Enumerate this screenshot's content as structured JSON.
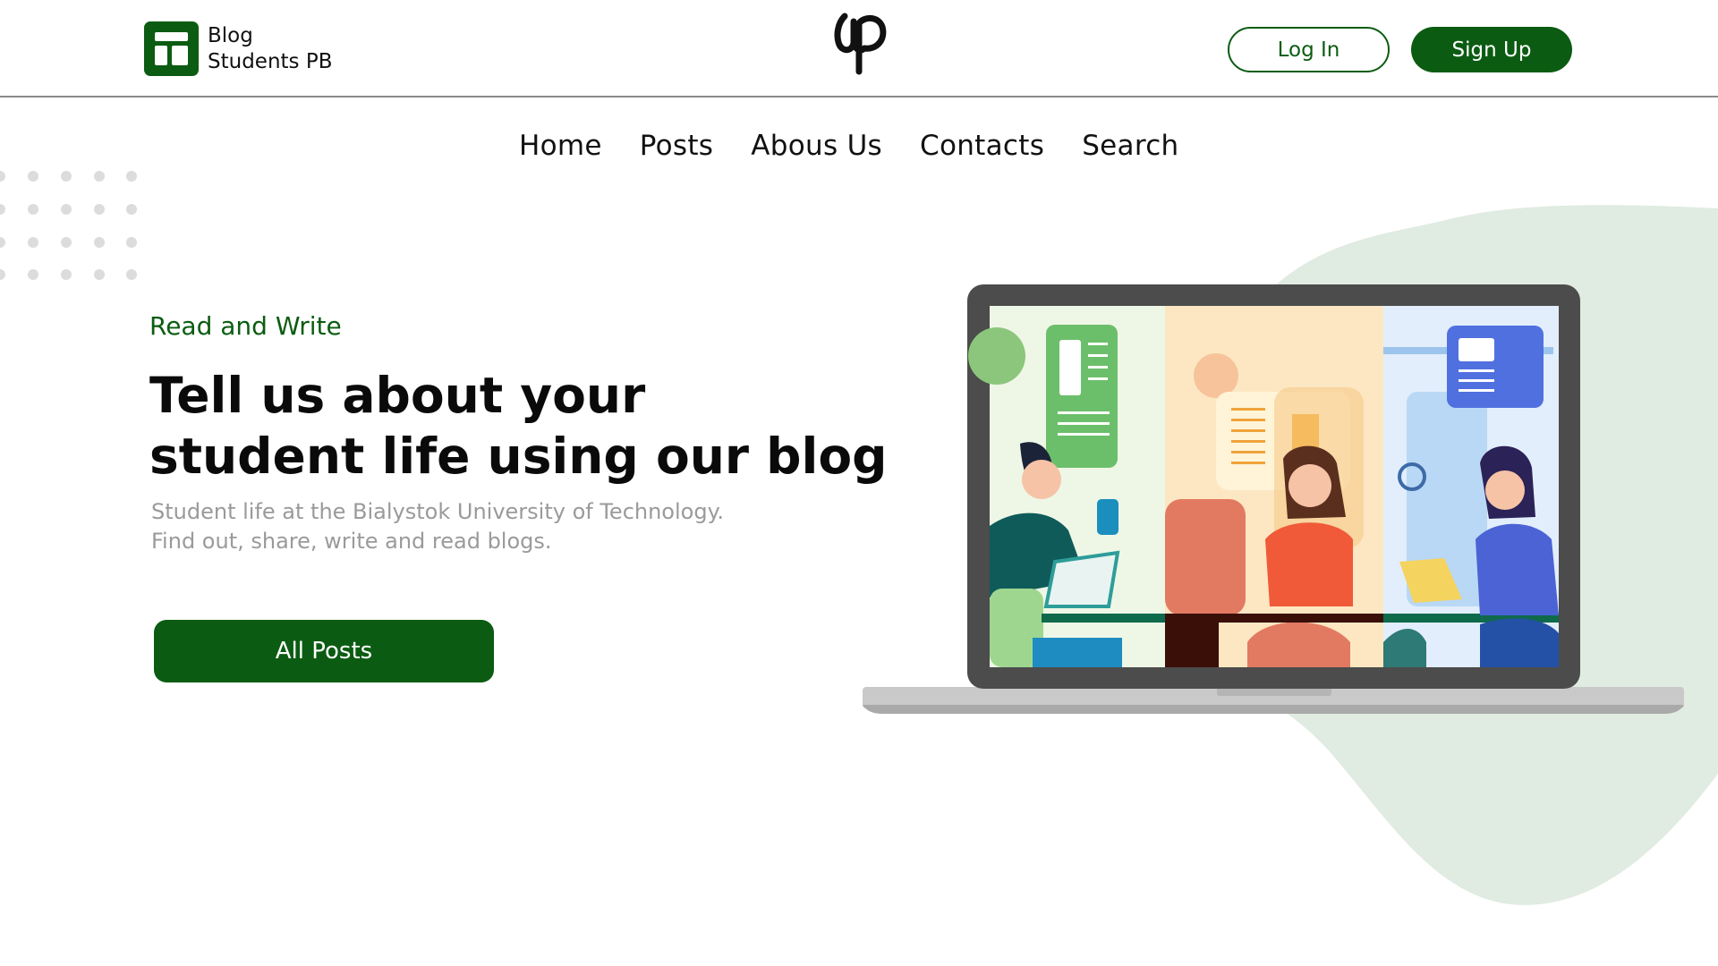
{
  "header": {
    "brand_line1": "Blog",
    "brand_line2": "Students PB",
    "login_label": "Log In",
    "signup_label": "Sign Up"
  },
  "nav": {
    "items": [
      {
        "label": "Home"
      },
      {
        "label": "Posts"
      },
      {
        "label": "Abous Us"
      },
      {
        "label": "Contacts"
      },
      {
        "label": "Search"
      }
    ]
  },
  "hero": {
    "eyebrow": "Read and Write",
    "headline_line1": "Tell us about your",
    "headline_line2": "student life using our blog",
    "sub_line1": "Student life at the Bialystok University of Technology.",
    "sub_line2": "Find out, share, write and read blogs.",
    "cta_label": "All Posts"
  },
  "colors": {
    "brand_green": "#0b5c12",
    "blob": "#e0ebe1",
    "dot_grey": "#dcdcdc",
    "subtext": "#9a9a9a"
  },
  "icons": {
    "logo": "layout-grid-icon",
    "center_mark": "bp-monogram-icon"
  }
}
